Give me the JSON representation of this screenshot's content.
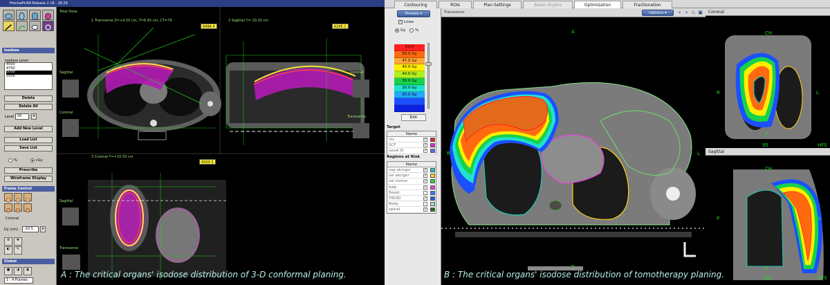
{
  "left_app": {
    "title": "PrecisePLAN Release 2.16 · 28.26",
    "isodose_header": "Isodose",
    "isodose_level_label": "Isodose Level",
    "isodose_levels": [
      "4500",
      "4750",
      "5000",
      "5500"
    ],
    "selected_level": "5000",
    "buttons": {
      "delete": "Delete",
      "delete_all": "Delete All",
      "add_new_level": "Add New Level",
      "load_list": "Load List",
      "save_list": "Save List",
      "prescribe": "Prescribe",
      "wireframe_display": "Wireframe Display"
    },
    "level_label": "Level",
    "level_value": "50",
    "percent_label": "%",
    "cgy_label": "cGy",
    "frame_control_header": "Frame Control",
    "coronal_label": "Coronal",
    "dy_label": "Dy (cm)",
    "dy_value": "-10.5",
    "global_header": "Global",
    "frames_select": "1 : 4 Frames",
    "views": {
      "total_dose": "Total Dose",
      "transverse_title": "1 Transverse Z=+4.20 cm, T=6.45 cm, CT=79",
      "sagittal_title": "2 Sagittal Y=-10.20 cm",
      "coronal_title": "3 Coronal Y=+10.50 cm",
      "badge_1": "6494.4",
      "badge_2": "6245.1",
      "badge_3": "6503.5",
      "thumb_sagittal": "Sagittal",
      "thumb_coronal": "Coronal",
      "thumb_transverse": "Transverse"
    },
    "caption": "A : The critical organs' isodose distribution of 3-D conformal planing."
  },
  "right_app": {
    "tabs": [
      "Contouring",
      "ROIs",
      "Plan Settings",
      "Beam Angles",
      "Optimization",
      "Fractionation"
    ],
    "presets_label": "Presets",
    "lines_label": "Lines",
    "gy_label": "Gy",
    "percent_label": "%",
    "isodose_levels": [
      {
        "label": "53.0",
        "color": "#ff2020"
      },
      {
        "label": "50.0 Gy",
        "color": "#ff6a10"
      },
      {
        "label": "47.5 Gy",
        "color": "#ffaa33"
      },
      {
        "label": "45.0 Gy",
        "color": "#ffee00"
      },
      {
        "label": "40.0 Gy",
        "color": "#b0f020"
      },
      {
        "label": "35.0 Gy",
        "color": "#16d24a"
      },
      {
        "label": "30.0 Gy",
        "color": "#20e0cf"
      },
      {
        "label": "25.0 Gy",
        "color": "#22a8ff"
      },
      {
        "label": "",
        "color": "#1a50ff"
      },
      {
        "label": "",
        "color": "#0e20e0"
      }
    ],
    "edit_label": "Edit",
    "target_title": "Target",
    "target_header": "Name",
    "targets": [
      {
        "name": "ctv",
        "checked": "✓",
        "color": "#e61f26"
      },
      {
        "name": "SCF",
        "checked": "✓",
        "color": "#e029c8"
      },
      {
        "name": "Level III",
        "checked": "✓",
        "color": "#5a6fe6"
      }
    ],
    "oar_title": "Regions at Risk",
    "oar_header": "Name",
    "oars": [
      {
        "name": "sag akciger",
        "checked": "✓",
        "color": "#1fc8b4"
      },
      {
        "name": "sol akciger",
        "checked": "✓",
        "color": "#ffd21a"
      },
      {
        "name": "sol meme",
        "checked": "✓",
        "color": "#22d838"
      },
      {
        "name": "kalp",
        "checked": "✓",
        "color": "#e83fe0"
      },
      {
        "name": "Boost",
        "checked": "",
        "color": "#3a78ff"
      },
      {
        "name": "TROID",
        "checked": "✓",
        "color": "#2a5af0"
      },
      {
        "name": "Body",
        "checked": "",
        "color": "#a2e0b8"
      },
      {
        "name": "spinal",
        "checked": "✓",
        "color": "#2a6a1a"
      }
    ],
    "main_view_title": "Transverse",
    "options_label": "Options",
    "orientation": {
      "anterior": "A",
      "posterior": "P",
      "left": "L",
      "right": "R"
    },
    "coronal_title": "Coronal",
    "sagittal_title": "Sagittal",
    "coronal_marks": {
      "top": "CH",
      "right": "L",
      "left": "R",
      "bottom": "F",
      "slice": "95",
      "hfs": "HFS"
    },
    "sagittal_marks": {
      "top": "CH",
      "left": "P",
      "right": "A",
      "bottom": "F",
      "slice": "106",
      "hfs": "HFS"
    },
    "caption": "B : The critical organs' isodose distribution of tomotherapy planing."
  }
}
